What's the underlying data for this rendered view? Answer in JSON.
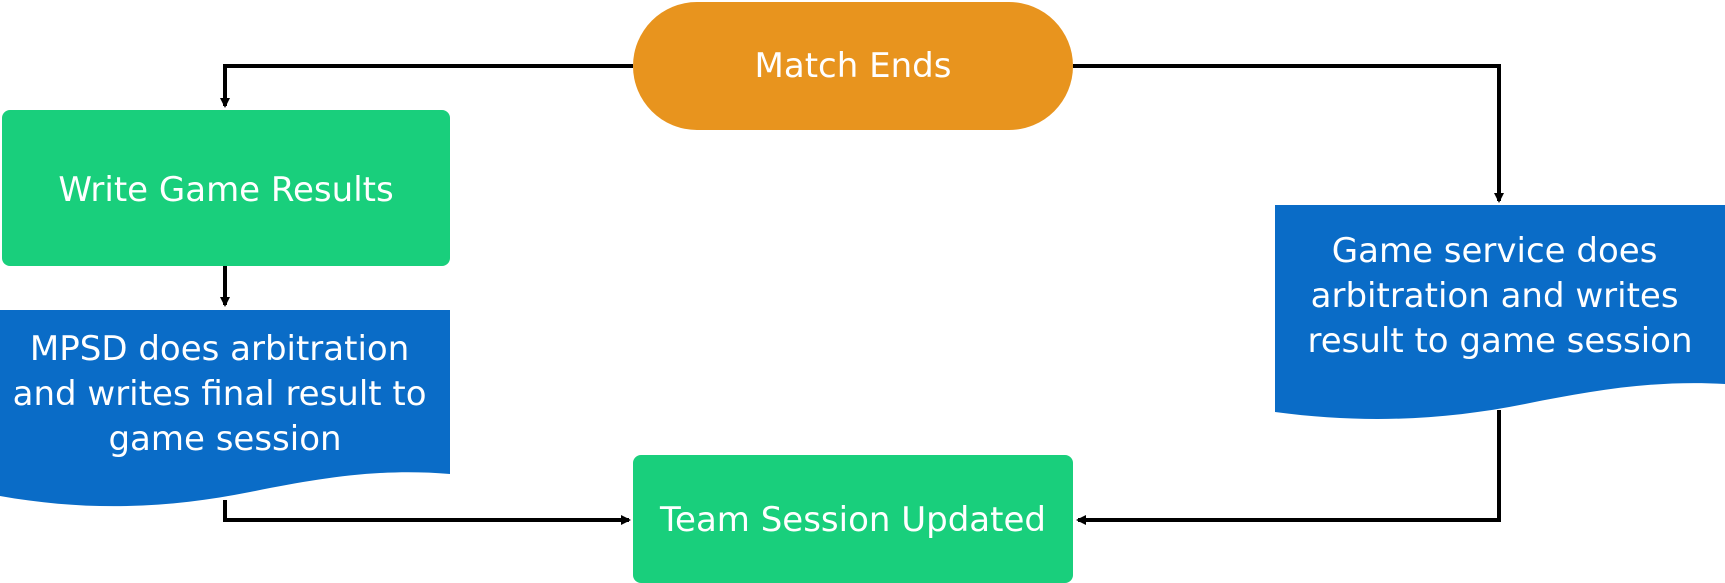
{
  "diagram": {
    "colors": {
      "terminator": "#E8941E",
      "process": "#19CF7C",
      "document": "#0A6CC7",
      "connector": "#000000",
      "text": "#FFFFFF"
    },
    "nodes": {
      "match_ends": {
        "label": "Match Ends"
      },
      "write_results": {
        "label": "Write Game Results"
      },
      "mpsd_arbitration": {
        "lines": [
          "MPSD does arbitration",
          "and writes final result to",
          "game session"
        ]
      },
      "game_service_arbitration": {
        "lines": [
          "Game service does",
          "arbitration and writes",
          "result to game session"
        ]
      },
      "team_session_updated": {
        "label": "Team Session Updated"
      }
    }
  }
}
